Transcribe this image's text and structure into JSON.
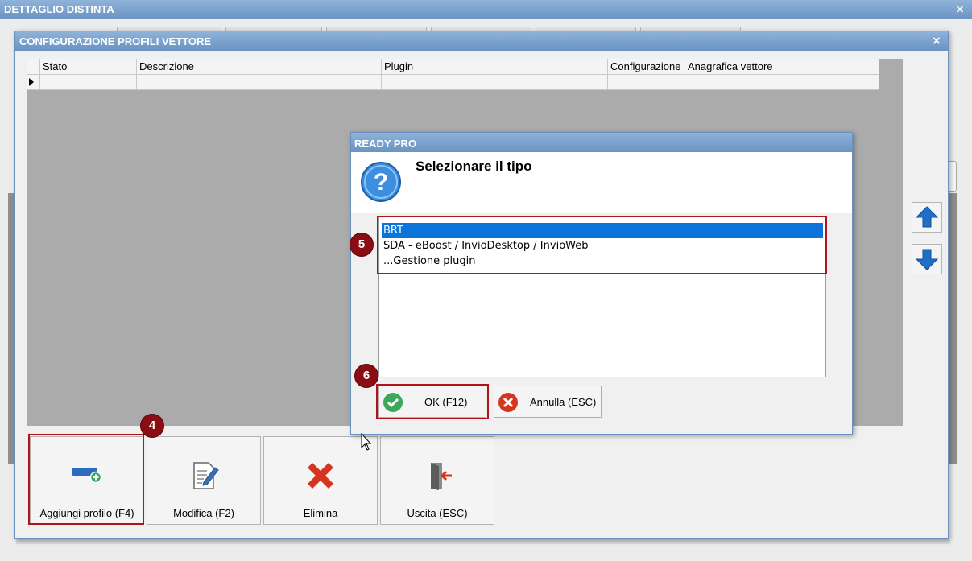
{
  "outer_window": {
    "title": "DETTAGLIO DISTINTA",
    "close": "×"
  },
  "inner_window": {
    "title": "CONFIGURAZIONE PROFILI VETTORE",
    "close": "×",
    "grid": {
      "columns": [
        "Stato",
        "Descrizione",
        "Plugin",
        "Configurazione",
        "Anagrafica vettore"
      ],
      "rows": [
        [
          "",
          "",
          "",
          "",
          ""
        ]
      ]
    },
    "actions": [
      {
        "label": "Aggiungi profilo (F4)",
        "icon": "add-profile-icon"
      },
      {
        "label": "Modifica (F2)",
        "icon": "edit-document-icon"
      },
      {
        "label": "Elimina",
        "icon": "delete-x-icon"
      },
      {
        "label": "Uscita (ESC)",
        "icon": "exit-door-icon"
      }
    ],
    "side_buttons": [
      {
        "icon": "arrow-up-icon"
      },
      {
        "icon": "arrow-down-icon"
      }
    ]
  },
  "dialog": {
    "title": "READY PRO",
    "icon": "question-icon",
    "message": "Selezionare il tipo",
    "options": [
      "BRT",
      "SDA - eBoost / InvioDesktop / InvioWeb",
      "...Gestione plugin"
    ],
    "selected": "BRT",
    "ok_label": "OK (F12)",
    "cancel_label": "Annulla (ESC)"
  },
  "annotations": {
    "badge_4": "4",
    "badge_5": "5",
    "badge_6": "6"
  },
  "colors": {
    "title_bar": "#6a93c2",
    "selection": "#0a74d8",
    "highlight": "#b1121c",
    "badge": "#8b0c12"
  }
}
